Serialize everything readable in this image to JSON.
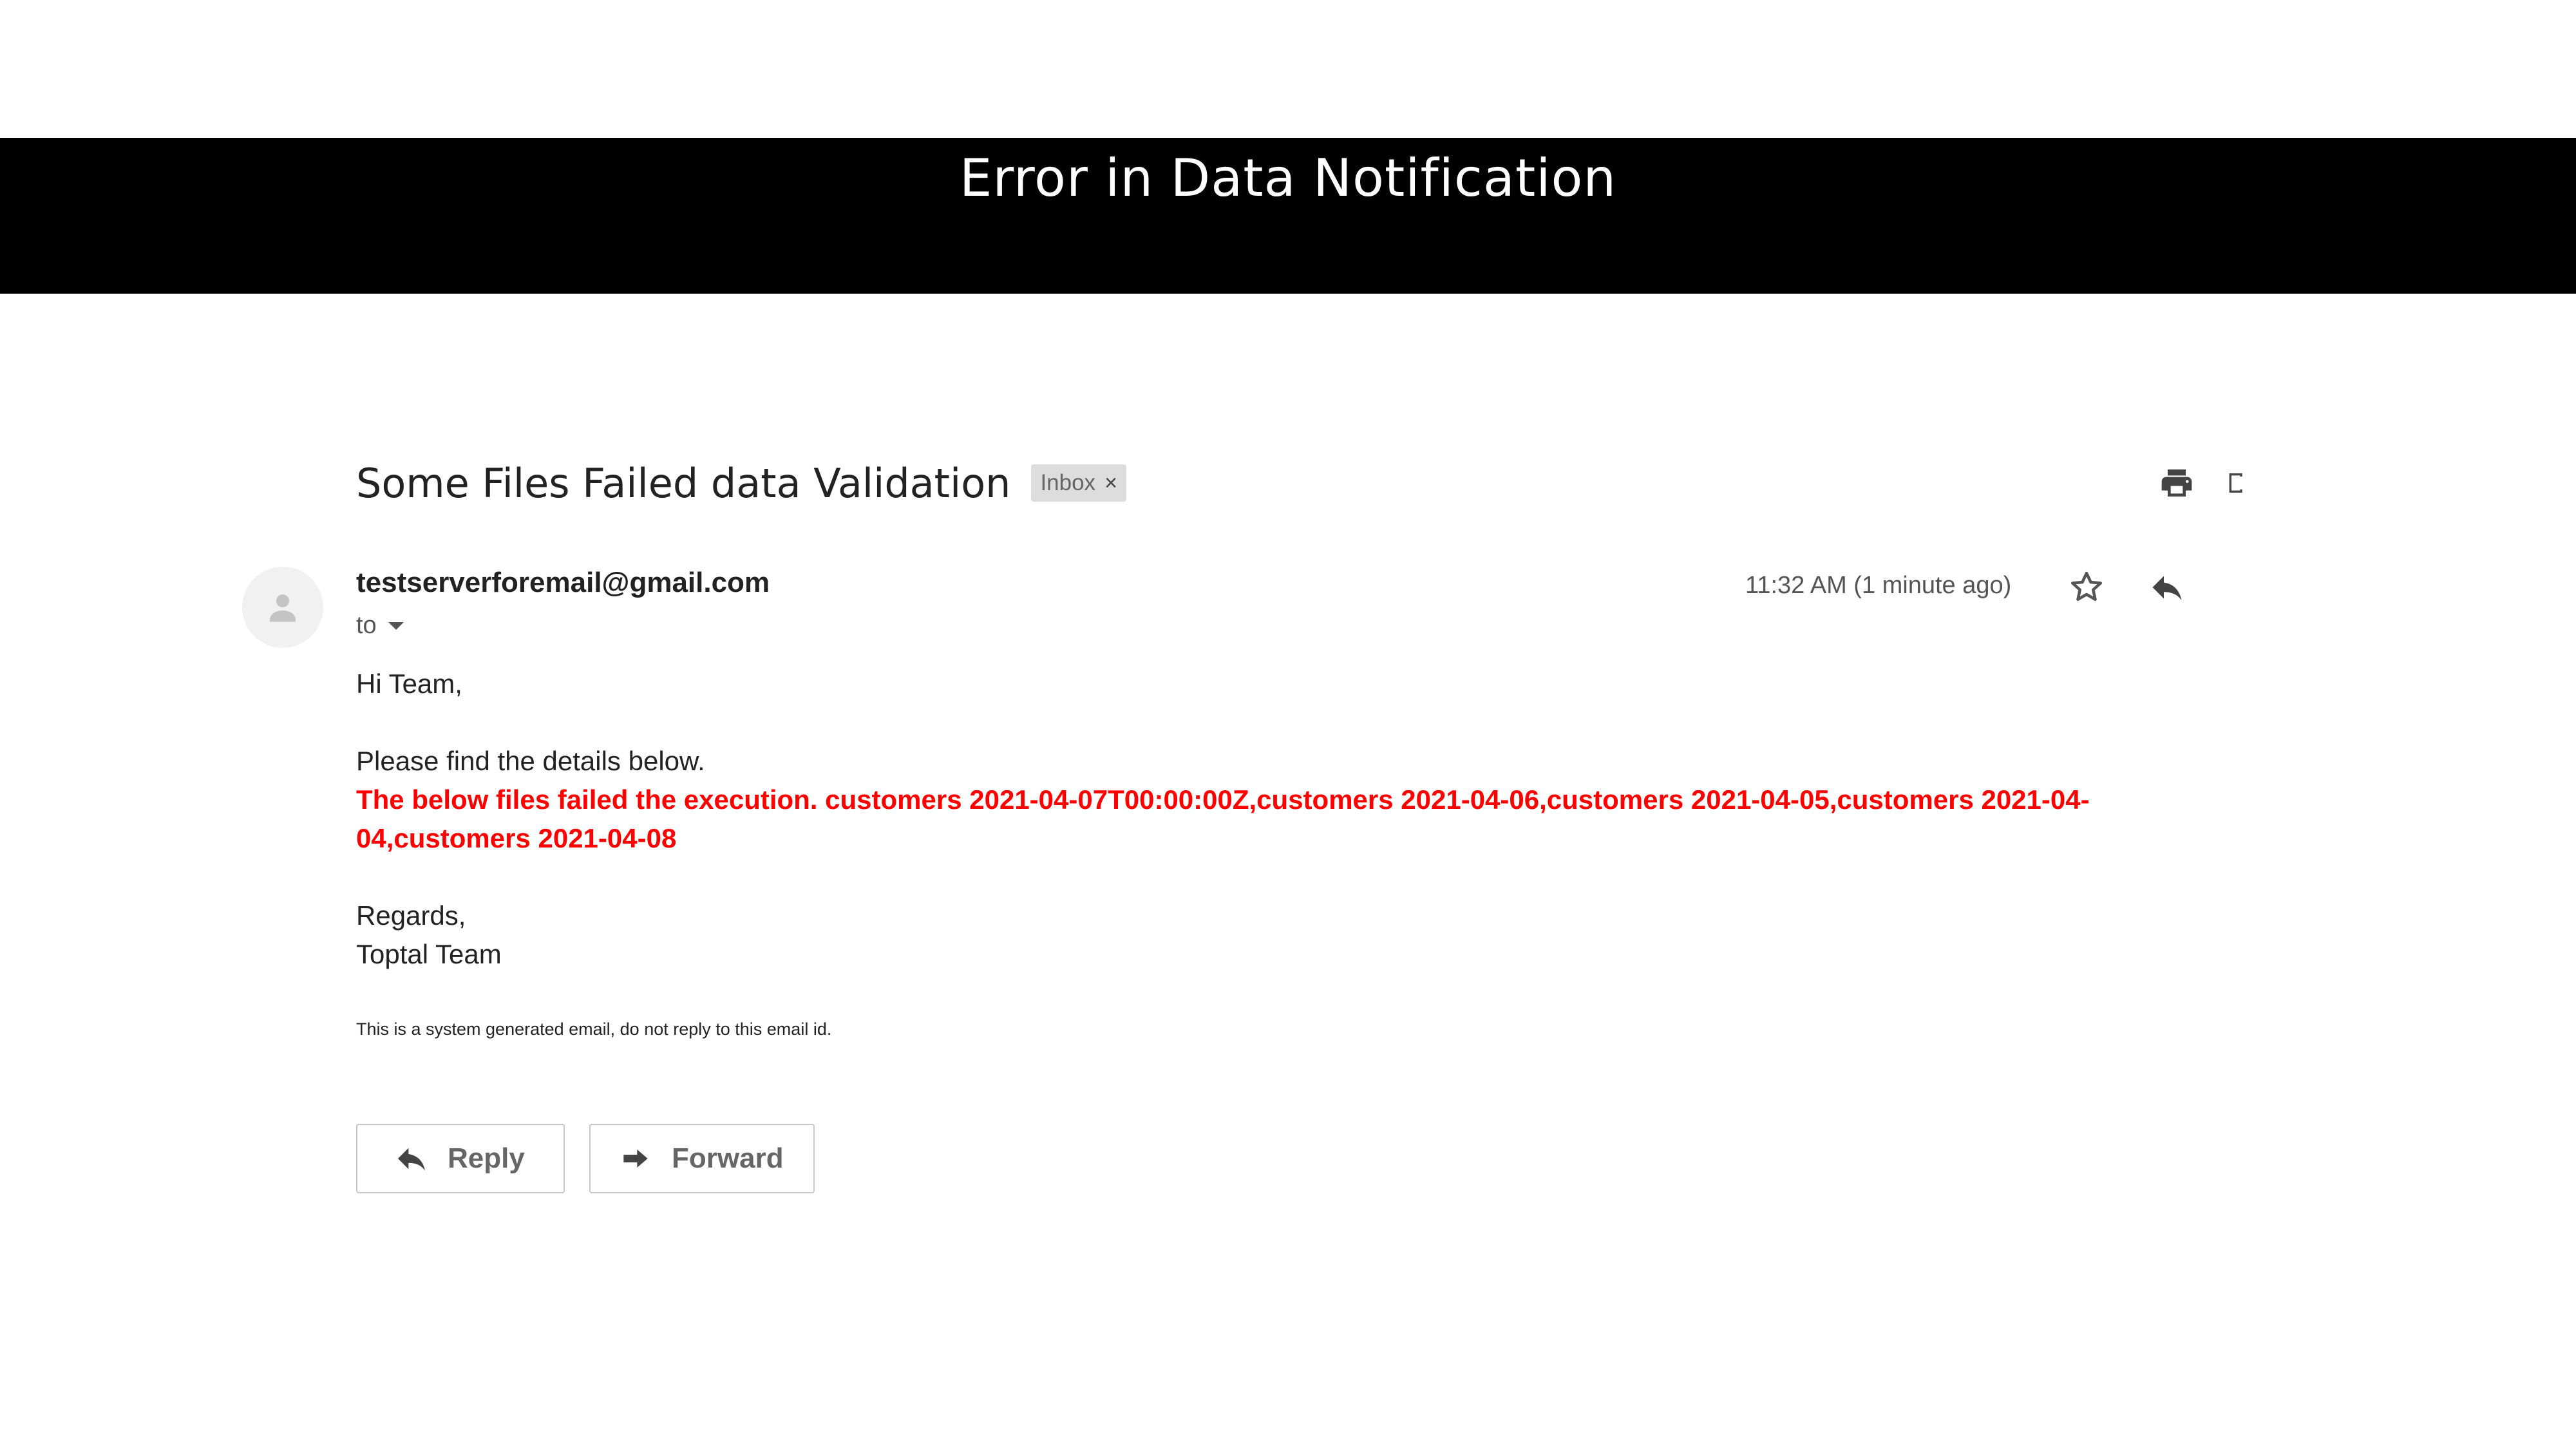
{
  "banner": {
    "title": "Error in Data Notification"
  },
  "email": {
    "subject": "Some Files Failed data Validation",
    "label": "Inbox",
    "label_close": "×",
    "sender": "testserverforemail@gmail.com",
    "to_label": "to",
    "timestamp": "11:32 AM (1 minute ago)",
    "body": {
      "greeting": "Hi Team,",
      "intro": "Please find the details below.",
      "error_message": "The below files failed the execution. customers 2021-04-07T00:00:00Z,customers 2021-04-06,customers 2021-04-05,customers 2021-04-04,customers 2021-04-08",
      "closing": "Regards,",
      "signature": "Toptal Team",
      "footer_note": "This is a system generated email, do not reply to this email id."
    }
  },
  "actions": {
    "reply_label": "Reply",
    "forward_label": "Forward"
  },
  "icons": {
    "print": "print-icon",
    "open_new_window": "new-window-icon",
    "star": "star-icon",
    "reply": "reply-icon",
    "forward": "forward-icon",
    "avatar": "person-icon",
    "dropdown": "caret-down-icon"
  },
  "colors": {
    "banner_background": "#000000",
    "error_text": "#ff0000",
    "label_chip": "#dddddd",
    "icon_gray": "#444444"
  }
}
